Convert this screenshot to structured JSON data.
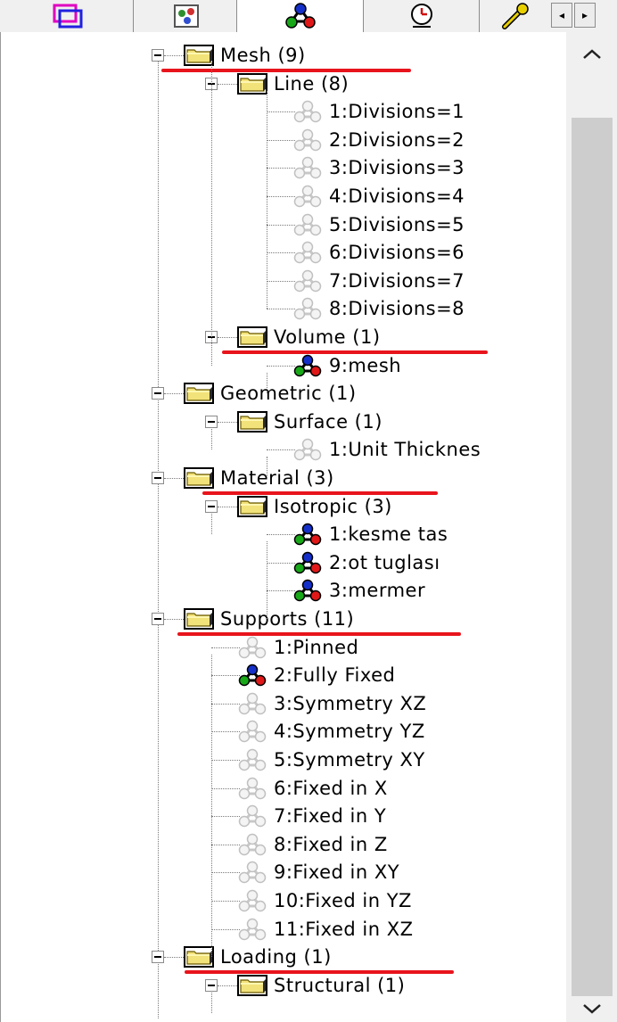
{
  "tabs": [
    {
      "name": "tab-overlap-squares",
      "icon": "overlap-squares-icon",
      "active": false
    },
    {
      "name": "tab-object-palette",
      "icon": "palette-icon",
      "active": false
    },
    {
      "name": "tab-attributes",
      "icon": "attribute-tree-icon",
      "active": true
    },
    {
      "name": "tab-analysis",
      "icon": "clock-icon",
      "active": false
    },
    {
      "name": "tab-tools",
      "icon": "wrench-icon",
      "active": false
    }
  ],
  "tab_scroll": {
    "left": "◂",
    "right": "▸"
  },
  "tree": {
    "mesh": {
      "label": "Mesh (9)"
    },
    "mesh_line": {
      "label": "Line (8)"
    },
    "line_items": [
      "1:Divisions=1",
      "2:Divisions=2",
      "3:Divisions=3",
      "4:Divisions=4",
      "5:Divisions=5",
      "6:Divisions=6",
      "7:Divisions=7",
      "8:Divisions=8"
    ],
    "mesh_volume": {
      "label": "Volume (1)"
    },
    "volume_items": [
      "9:mesh"
    ],
    "geometric": {
      "label": "Geometric (1)"
    },
    "geo_surface": {
      "label": "Surface (1)"
    },
    "surface_items": [
      "1:Unit Thicknes"
    ],
    "material": {
      "label": "Material (3)"
    },
    "mat_isotropic": {
      "label": "Isotropic (3)"
    },
    "isotropic_items": [
      "1:kesme tas",
      "2:ot tuglası",
      "3:mermer"
    ],
    "supports": {
      "label": "Supports (11)"
    },
    "support_items": [
      "1:Pinned",
      "2:Fully Fixed",
      "3:Symmetry XZ",
      "4:Symmetry YZ",
      "5:Symmetry XY",
      "6:Fixed in X",
      "7:Fixed in Y",
      "8:Fixed in Z",
      "9:Fixed in XY",
      "10:Fixed in YZ",
      "11:Fixed in XZ"
    ],
    "loading": {
      "label": "Loading (1)"
    },
    "load_structural": {
      "label": "Structural (1)"
    }
  },
  "colors": {
    "highlight_underline": "#e8141c",
    "folder_yellow": "#f2e27a",
    "selection_box": "#000000",
    "icon_blue": "#1530c8",
    "icon_green": "#18a818",
    "icon_red": "#e01818"
  }
}
